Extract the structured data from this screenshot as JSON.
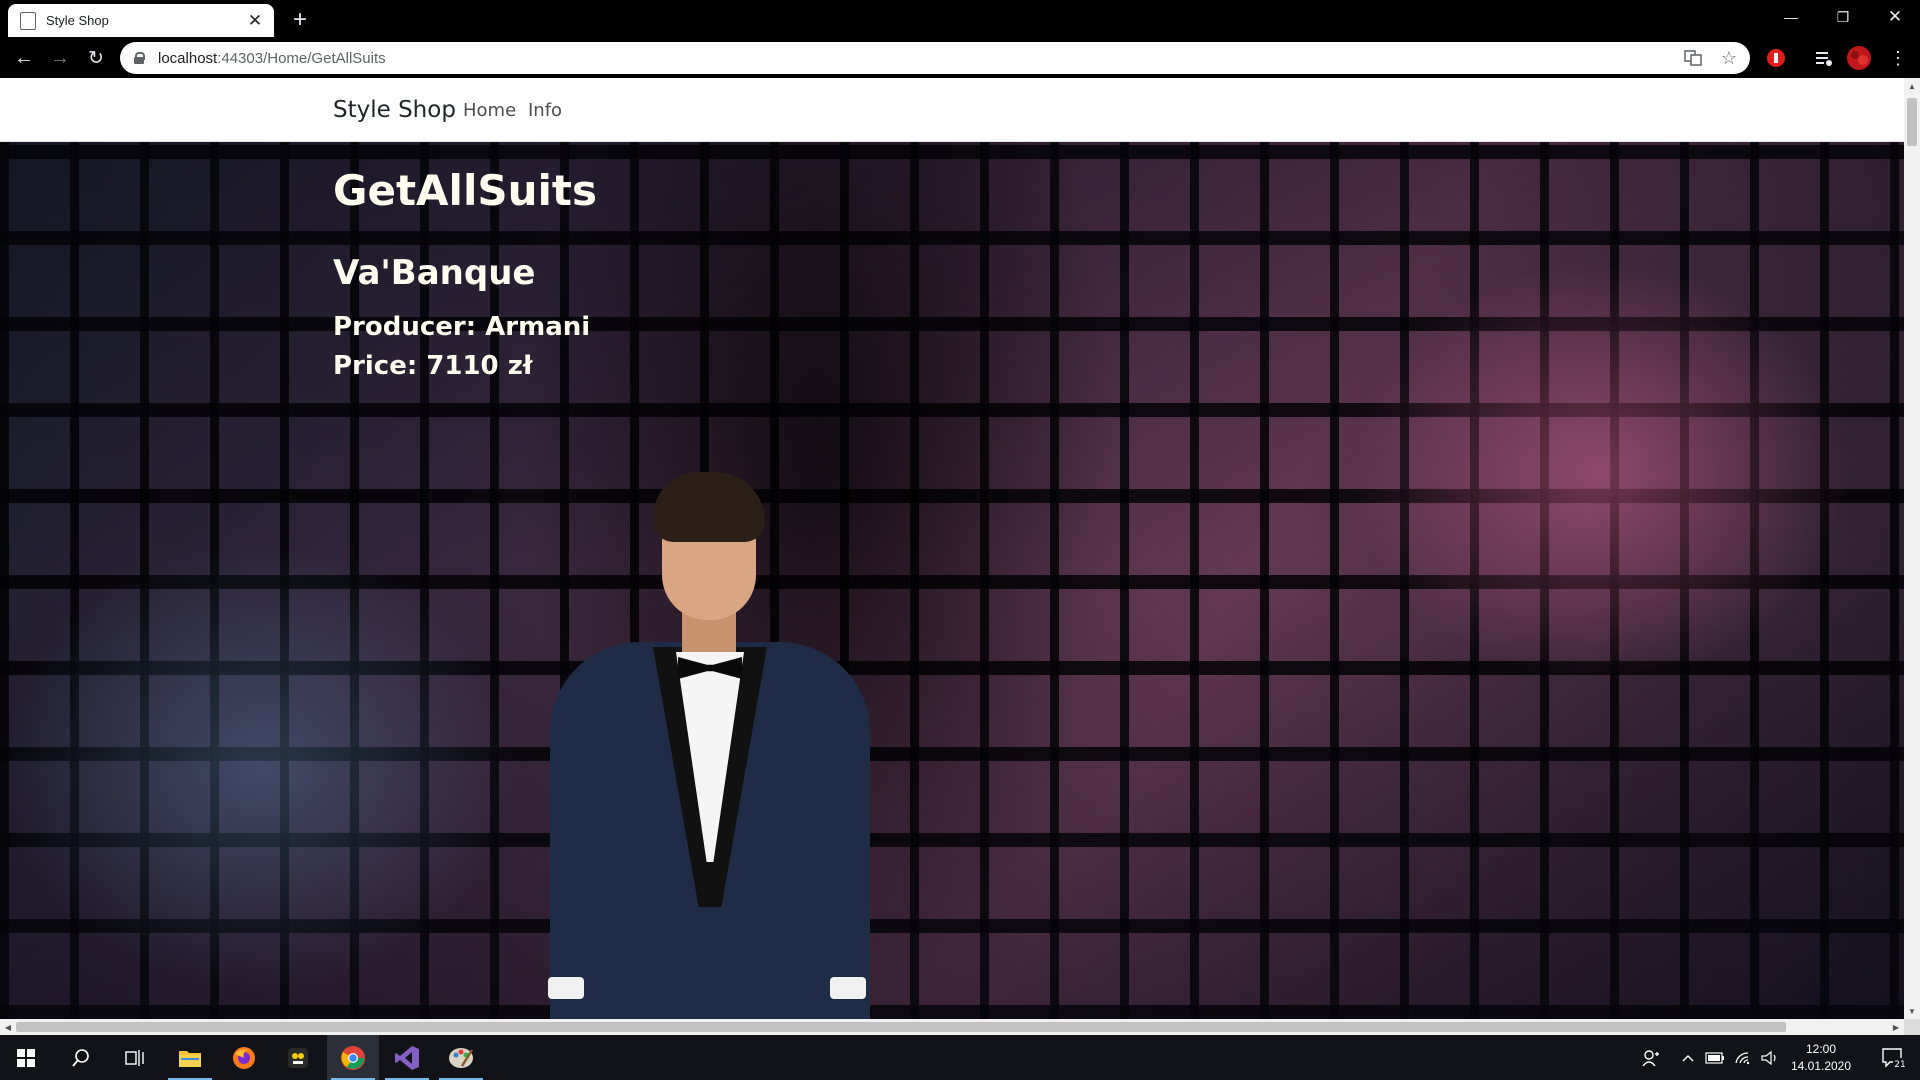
{
  "browser": {
    "tab_title": "Style Shop",
    "url_host": "localhost",
    "url_path": ":44303/Home/GetAllSuits"
  },
  "site": {
    "brand": "Style Shop",
    "nav": [
      {
        "label": "Home"
      },
      {
        "label": "Info"
      }
    ]
  },
  "page": {
    "heading": "GetAllSuits",
    "product": {
      "name": "Va'Banque",
      "producer": "Producer: Armani",
      "price": "Price: 7110 zł"
    }
  },
  "taskbar": {
    "time": "12:00",
    "date": "14.01.2020",
    "notifications": "21"
  },
  "colors": {
    "heading_text": "#fffdf0",
    "navbar_bg": "#ffffff",
    "browser_frame": "#000000",
    "taskbar_bg": "#111318"
  }
}
